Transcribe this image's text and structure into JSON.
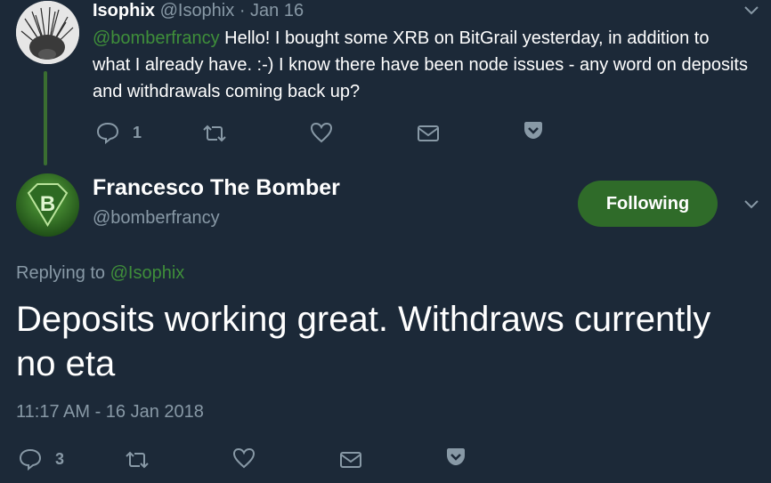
{
  "parent_tweet": {
    "name": "Isophix",
    "handle": "@Isophix",
    "separator": "·",
    "date": "Jan 16",
    "mention": "@bomberfrancy",
    "text": " Hello! I bought some XRB on BitGrail yesterday, in addition to what I already have. :-) I know there have been node issues - any word on deposits and withdrawals coming back up?",
    "reply_count": "1"
  },
  "main_tweet": {
    "name": "Francesco The Bomber",
    "handle": "@bomberfrancy",
    "follow_label": "Following",
    "replying_prefix": "Replying to ",
    "replying_to": "@Isophix",
    "text": "Deposits working great. Withdraws currently no eta",
    "timestamp": "11:17 AM - 16 Jan 2018",
    "reply_count": "3"
  },
  "icons": {
    "reply": "reply-icon",
    "retweet": "retweet-icon",
    "like": "heart-icon",
    "dm": "envelope-icon",
    "pocket": "pocket-icon",
    "menu": "chevron-down-icon"
  },
  "colors": {
    "background": "#1c2938",
    "muted": "#8899a6",
    "link": "#3f8f3a",
    "follow_button": "#2f6b29"
  }
}
